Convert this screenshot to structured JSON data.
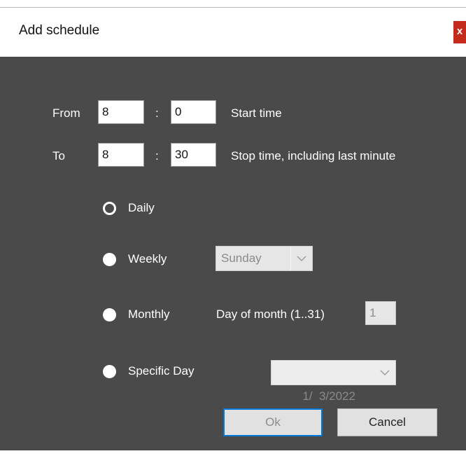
{
  "window": {
    "title": "Add schedule",
    "close_label": "x"
  },
  "time": {
    "from_label": "From",
    "to_label": "To",
    "separator": ":",
    "from_hour": "8",
    "from_minute": "0",
    "to_hour": "8",
    "to_minute": "30",
    "start_hint": "Start time",
    "stop_hint": "Stop time, including last minute"
  },
  "schedule": {
    "daily_label": "Daily",
    "weekly_label": "Weekly",
    "monthly_label": "Monthly",
    "specific_label": "Specific Day",
    "selected": "Daily",
    "weekday_value": "Sunday",
    "day_of_month_label": "Day of month (1..31)",
    "day_of_month_value": "1",
    "specific_date_value": "1/  3/2022"
  },
  "buttons": {
    "ok_label": "Ok",
    "cancel_label": "Cancel"
  },
  "colors": {
    "client_bg": "#4a4a4a",
    "close_bg": "#c42b1c",
    "default_button_border": "#0078d7"
  }
}
